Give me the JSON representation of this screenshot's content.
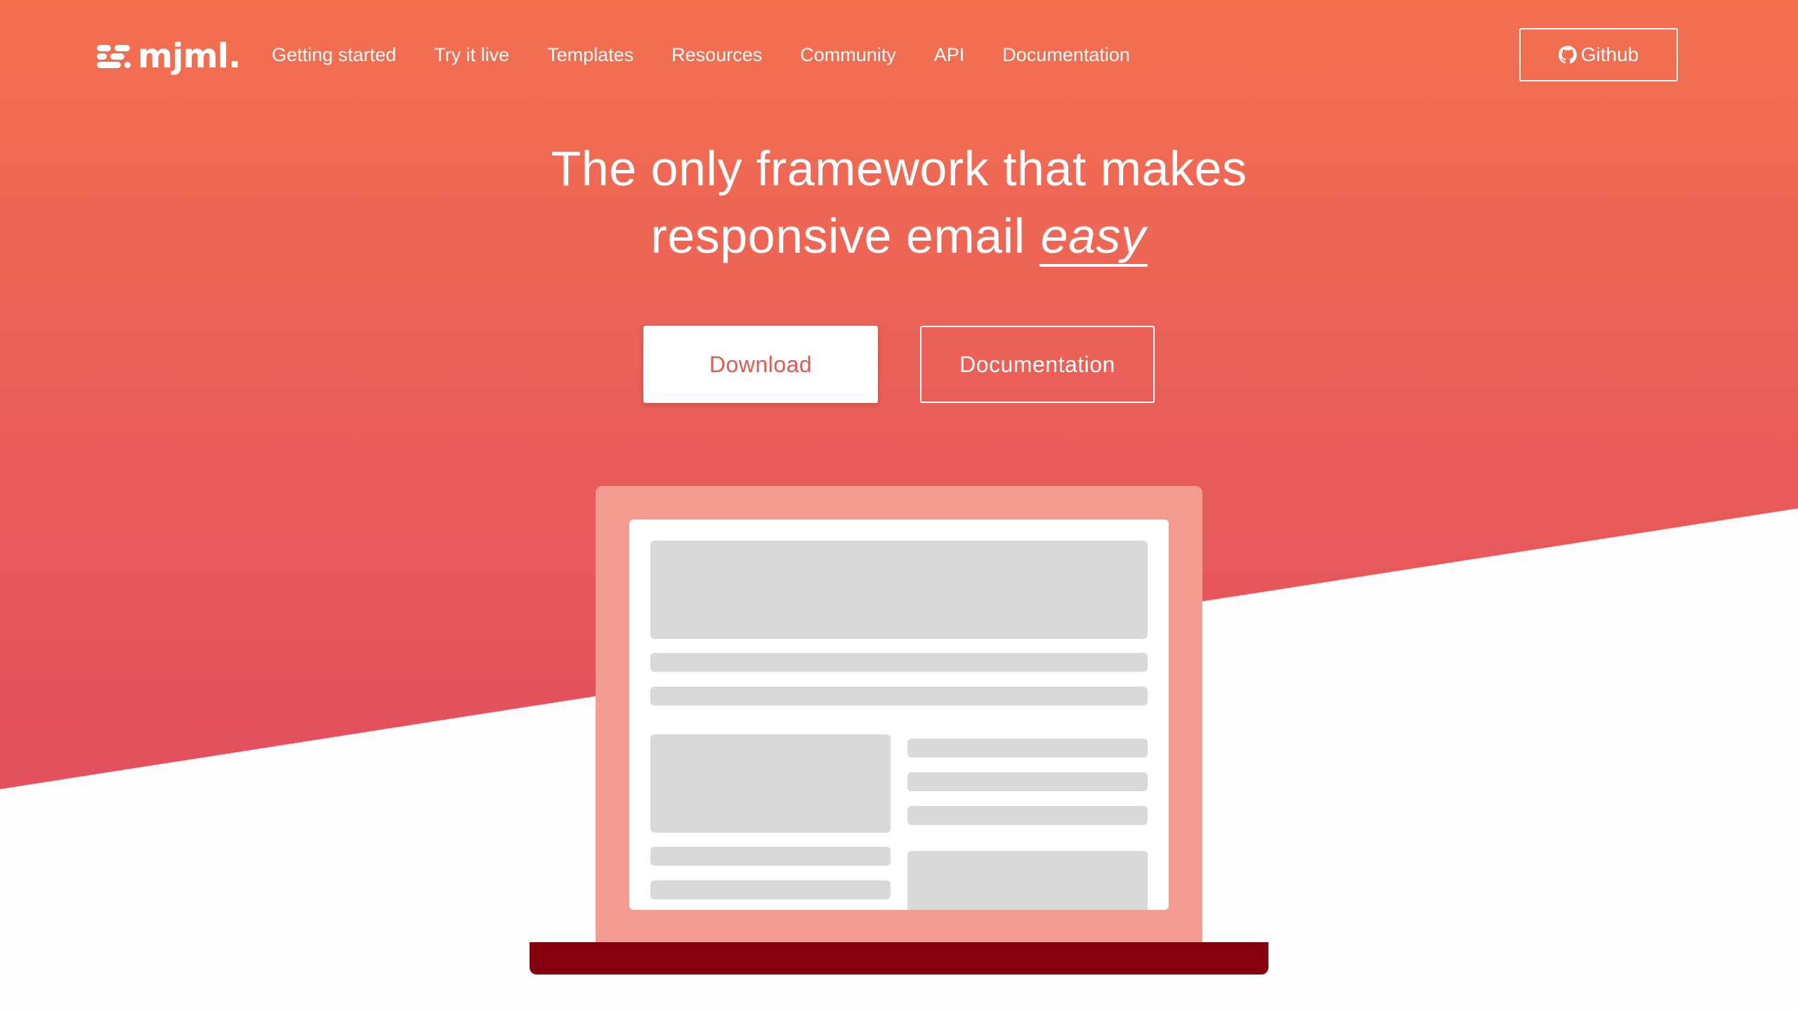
{
  "brand": {
    "logo_text": "mjml.",
    "accent_color": "#f4704f",
    "hero_bottom_color": "#e24f5f",
    "laptop_screen_color": "#f49b91",
    "laptop_base_color": "#85000f"
  },
  "nav": {
    "links": [
      {
        "label": "Getting started"
      },
      {
        "label": "Try it live"
      },
      {
        "label": "Templates"
      },
      {
        "label": "Resources"
      },
      {
        "label": "Community"
      },
      {
        "label": "API"
      },
      {
        "label": "Documentation"
      }
    ],
    "github": {
      "label": "Github",
      "icon": "github-icon"
    }
  },
  "hero": {
    "line1": "The only framework that makes",
    "line2_prefix": "responsive email ",
    "line2_emphasis": "easy"
  },
  "actions": {
    "download_label": "Download",
    "documentation_label": "Documentation"
  }
}
